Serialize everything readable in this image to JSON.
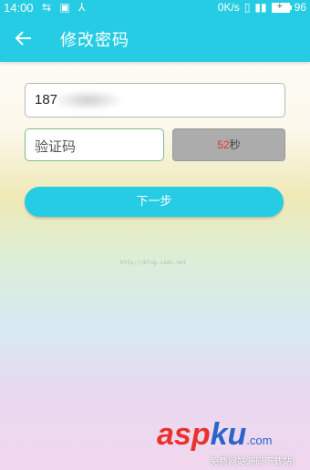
{
  "status_bar": {
    "time": "14:00",
    "icons_left": "⇆ ▣ ⅄",
    "speed": "0K/s",
    "battery_percent": "96"
  },
  "app_bar": {
    "title": "修改密码"
  },
  "form": {
    "phone_value": "187",
    "code_placeholder": "验证码",
    "countdown_number": "52",
    "countdown_unit": "秒",
    "next_label": "下一步"
  },
  "watermark": {
    "url": "http://blog.csdn.net",
    "logo_asp": "asp",
    "logo_ku": "ku",
    "logo_com": ".com",
    "logo_sub": "免费网站源码下载站!"
  },
  "colors": {
    "accent": "#25cce3",
    "countdown_red": "#e8322b"
  }
}
